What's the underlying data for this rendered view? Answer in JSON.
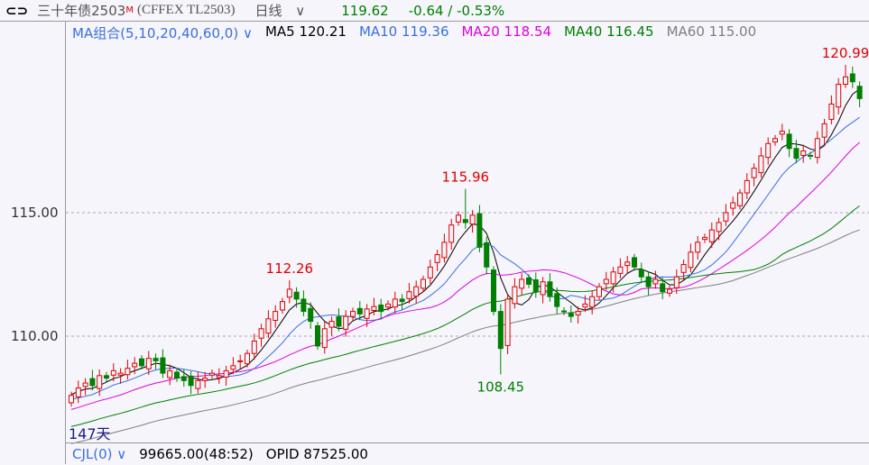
{
  "header": {
    "title": "三十年债2503",
    "title_mark": "M",
    "code": "(CFFEX  TL2503)",
    "period": "日线",
    "price": "119.62",
    "change": "-0.64 / -0.53%"
  },
  "ma_bar": {
    "selector": "MA组合(5,10,20,40,60,0)",
    "items": [
      {
        "label": "MA5 120.21",
        "color": "#000000"
      },
      {
        "label": "MA10 119.36",
        "color": "#3a6fe0"
      },
      {
        "label": "MA20 118.54",
        "color": "#e000e0"
      },
      {
        "label": "MA40 116.45",
        "color": "#008000"
      },
      {
        "label": "MA60 115.00",
        "color": "#808080"
      }
    ]
  },
  "footer": {
    "indicator": "CJL(0)",
    "volume": "99665.00(48:52)",
    "opid": "OPID 87525.00"
  },
  "days_label": "147天",
  "chart_data": {
    "type": "candlestick",
    "yticks": [
      "115.00",
      "110.00"
    ],
    "ytick_values": [
      115,
      110
    ],
    "closes": [
      107.6,
      107.9,
      108.1,
      108.0,
      108.4,
      108.3,
      108.6,
      108.5,
      108.7,
      108.9,
      108.8,
      109.1,
      109.0,
      108.5,
      108.6,
      108.3,
      108.2,
      108.0,
      108.2,
      108.3,
      108.5,
      108.4,
      108.6,
      108.8,
      109.0,
      109.3,
      109.8,
      110.3,
      110.7,
      111.0,
      111.4,
      111.9,
      111.5,
      111.0,
      110.6,
      109.6,
      110.3,
      110.6,
      110.4,
      110.8,
      111.0,
      110.9,
      111.1,
      111.2,
      111.0,
      111.3,
      111.5,
      111.4,
      111.8,
      112.0,
      112.3,
      112.8,
      113.3,
      113.8,
      114.5,
      114.9,
      114.6,
      114.9,
      113.6,
      112.8,
      111.0,
      109.5,
      111.5,
      112.0,
      112.3,
      112.1,
      111.8,
      112.2,
      111.6,
      111.2,
      111.0,
      110.8,
      111.0,
      111.3,
      111.6,
      112.0,
      112.3,
      112.6,
      112.8,
      113.0,
      112.8,
      112.4,
      112.0,
      112.3,
      111.8,
      111.9,
      112.4,
      112.9,
      113.4,
      113.8,
      114.0,
      114.3,
      114.6,
      115.0,
      115.4,
      115.8,
      116.3,
      116.8,
      117.3,
      117.8,
      118.0,
      118.3,
      117.6,
      117.2,
      117.5,
      117.3,
      118.0,
      118.6,
      119.4,
      120.2,
      120.5,
      120.3,
      119.62
    ],
    "annotations": [
      {
        "index": 31,
        "value": 112.26,
        "label": "112.26",
        "kind": "high"
      },
      {
        "index": 56,
        "value": 115.96,
        "label": "115.96",
        "kind": "high"
      },
      {
        "index": 61,
        "value": 108.45,
        "label": "108.45",
        "kind": "low"
      },
      {
        "index": 110,
        "value": 120.99,
        "label": "120.99",
        "kind": "high"
      }
    ],
    "up_color": "#e00000",
    "down_color": "#008000"
  }
}
